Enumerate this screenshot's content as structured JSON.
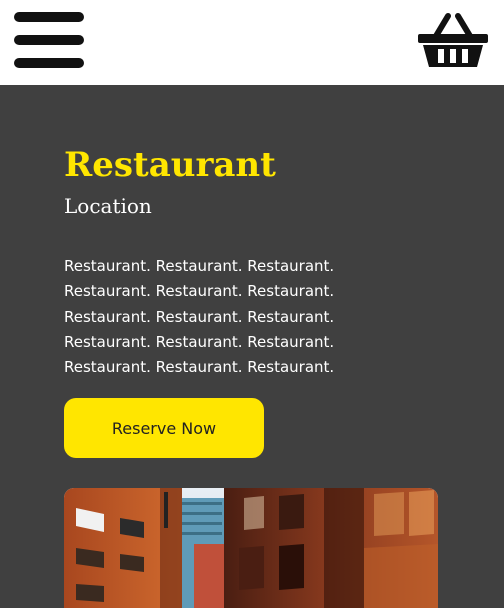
{
  "header": {
    "menu_icon": "hamburger-menu-icon",
    "basket_icon": "shopping-basket-icon"
  },
  "hero": {
    "title": "Restaurant",
    "subtitle": "Location",
    "description": "Restaurant. Restaurant. Restaurant. Restaurant. Restaurant. Restaurant. Restaurant. Restaurant. Restaurant. Restaurant. Restaurant. Restaurant. Restaurant. Restaurant. Restaurant.",
    "reserve_label": "Reserve Now"
  },
  "colors": {
    "background": "#404040",
    "header_background": "#ffffff",
    "accent": "#ffe600",
    "text": "#ffffff"
  }
}
